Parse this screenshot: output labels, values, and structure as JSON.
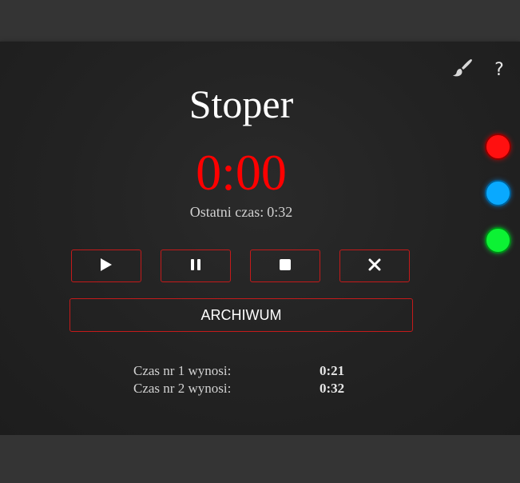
{
  "app": {
    "title": "Stoper",
    "timer_display": "0:00",
    "last_time_label": "Ostatni czas:",
    "last_time_value": "0:32"
  },
  "controls": [
    {
      "name": "play-button",
      "icon": "play-icon"
    },
    {
      "name": "pause-button",
      "icon": "pause-icon"
    },
    {
      "name": "stop-button",
      "icon": "stop-icon"
    },
    {
      "name": "reset-button",
      "icon": "close-icon"
    }
  ],
  "archive": {
    "label": "ARCHIWUM"
  },
  "history": [
    {
      "label": "Czas nr 1 wynosi:",
      "value": "0:21"
    },
    {
      "label": "Czas nr 2 wynosi:",
      "value": "0:32"
    }
  ],
  "toolbar": {
    "theme_icon": "paintbrush-icon",
    "help_label": "?"
  },
  "color_options": [
    {
      "name": "red",
      "color": "#ff1010"
    },
    {
      "name": "blue",
      "color": "#09a9ff"
    },
    {
      "name": "green",
      "color": "#0cf234"
    }
  ],
  "colors": {
    "accent": "#ff0000",
    "button_border": "#c51a1a",
    "panel_bg": "#222222",
    "page_bg": "#343434"
  }
}
